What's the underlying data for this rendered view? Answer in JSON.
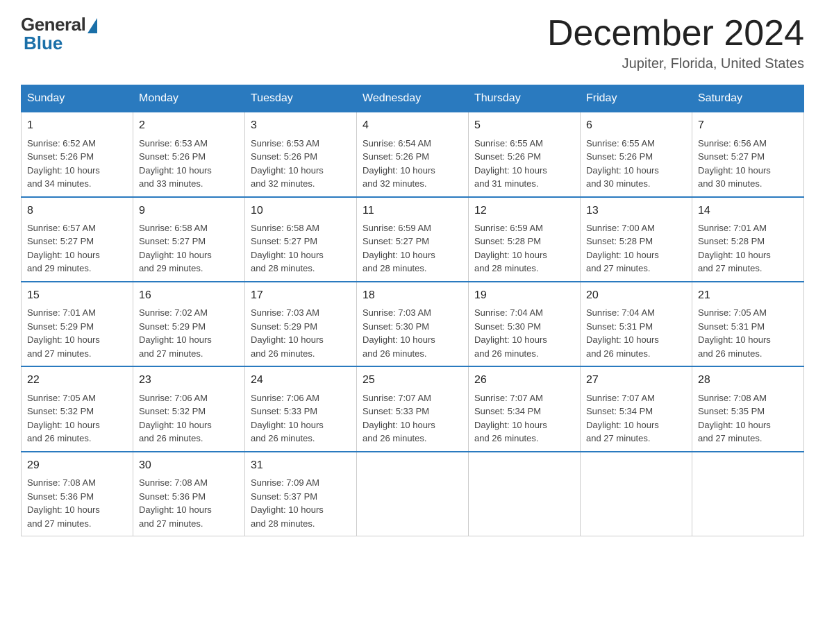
{
  "logo": {
    "general": "General",
    "blue": "Blue"
  },
  "title": "December 2024",
  "location": "Jupiter, Florida, United States",
  "weekdays": [
    "Sunday",
    "Monday",
    "Tuesday",
    "Wednesday",
    "Thursday",
    "Friday",
    "Saturday"
  ],
  "weeks": [
    [
      {
        "day": "1",
        "sunrise": "6:52 AM",
        "sunset": "5:26 PM",
        "daylight": "10 hours and 34 minutes."
      },
      {
        "day": "2",
        "sunrise": "6:53 AM",
        "sunset": "5:26 PM",
        "daylight": "10 hours and 33 minutes."
      },
      {
        "day": "3",
        "sunrise": "6:53 AM",
        "sunset": "5:26 PM",
        "daylight": "10 hours and 32 minutes."
      },
      {
        "day": "4",
        "sunrise": "6:54 AM",
        "sunset": "5:26 PM",
        "daylight": "10 hours and 32 minutes."
      },
      {
        "day": "5",
        "sunrise": "6:55 AM",
        "sunset": "5:26 PM",
        "daylight": "10 hours and 31 minutes."
      },
      {
        "day": "6",
        "sunrise": "6:55 AM",
        "sunset": "5:26 PM",
        "daylight": "10 hours and 30 minutes."
      },
      {
        "day": "7",
        "sunrise": "6:56 AM",
        "sunset": "5:27 PM",
        "daylight": "10 hours and 30 minutes."
      }
    ],
    [
      {
        "day": "8",
        "sunrise": "6:57 AM",
        "sunset": "5:27 PM",
        "daylight": "10 hours and 29 minutes."
      },
      {
        "day": "9",
        "sunrise": "6:58 AM",
        "sunset": "5:27 PM",
        "daylight": "10 hours and 29 minutes."
      },
      {
        "day": "10",
        "sunrise": "6:58 AM",
        "sunset": "5:27 PM",
        "daylight": "10 hours and 28 minutes."
      },
      {
        "day": "11",
        "sunrise": "6:59 AM",
        "sunset": "5:27 PM",
        "daylight": "10 hours and 28 minutes."
      },
      {
        "day": "12",
        "sunrise": "6:59 AM",
        "sunset": "5:28 PM",
        "daylight": "10 hours and 28 minutes."
      },
      {
        "day": "13",
        "sunrise": "7:00 AM",
        "sunset": "5:28 PM",
        "daylight": "10 hours and 27 minutes."
      },
      {
        "day": "14",
        "sunrise": "7:01 AM",
        "sunset": "5:28 PM",
        "daylight": "10 hours and 27 minutes."
      }
    ],
    [
      {
        "day": "15",
        "sunrise": "7:01 AM",
        "sunset": "5:29 PM",
        "daylight": "10 hours and 27 minutes."
      },
      {
        "day": "16",
        "sunrise": "7:02 AM",
        "sunset": "5:29 PM",
        "daylight": "10 hours and 27 minutes."
      },
      {
        "day": "17",
        "sunrise": "7:03 AM",
        "sunset": "5:29 PM",
        "daylight": "10 hours and 26 minutes."
      },
      {
        "day": "18",
        "sunrise": "7:03 AM",
        "sunset": "5:30 PM",
        "daylight": "10 hours and 26 minutes."
      },
      {
        "day": "19",
        "sunrise": "7:04 AM",
        "sunset": "5:30 PM",
        "daylight": "10 hours and 26 minutes."
      },
      {
        "day": "20",
        "sunrise": "7:04 AM",
        "sunset": "5:31 PM",
        "daylight": "10 hours and 26 minutes."
      },
      {
        "day": "21",
        "sunrise": "7:05 AM",
        "sunset": "5:31 PM",
        "daylight": "10 hours and 26 minutes."
      }
    ],
    [
      {
        "day": "22",
        "sunrise": "7:05 AM",
        "sunset": "5:32 PM",
        "daylight": "10 hours and 26 minutes."
      },
      {
        "day": "23",
        "sunrise": "7:06 AM",
        "sunset": "5:32 PM",
        "daylight": "10 hours and 26 minutes."
      },
      {
        "day": "24",
        "sunrise": "7:06 AM",
        "sunset": "5:33 PM",
        "daylight": "10 hours and 26 minutes."
      },
      {
        "day": "25",
        "sunrise": "7:07 AM",
        "sunset": "5:33 PM",
        "daylight": "10 hours and 26 minutes."
      },
      {
        "day": "26",
        "sunrise": "7:07 AM",
        "sunset": "5:34 PM",
        "daylight": "10 hours and 26 minutes."
      },
      {
        "day": "27",
        "sunrise": "7:07 AM",
        "sunset": "5:34 PM",
        "daylight": "10 hours and 27 minutes."
      },
      {
        "day": "28",
        "sunrise": "7:08 AM",
        "sunset": "5:35 PM",
        "daylight": "10 hours and 27 minutes."
      }
    ],
    [
      {
        "day": "29",
        "sunrise": "7:08 AM",
        "sunset": "5:36 PM",
        "daylight": "10 hours and 27 minutes."
      },
      {
        "day": "30",
        "sunrise": "7:08 AM",
        "sunset": "5:36 PM",
        "daylight": "10 hours and 27 minutes."
      },
      {
        "day": "31",
        "sunrise": "7:09 AM",
        "sunset": "5:37 PM",
        "daylight": "10 hours and 28 minutes."
      },
      null,
      null,
      null,
      null
    ]
  ],
  "labels": {
    "sunrise": "Sunrise:",
    "sunset": "Sunset:",
    "daylight": "Daylight:"
  }
}
